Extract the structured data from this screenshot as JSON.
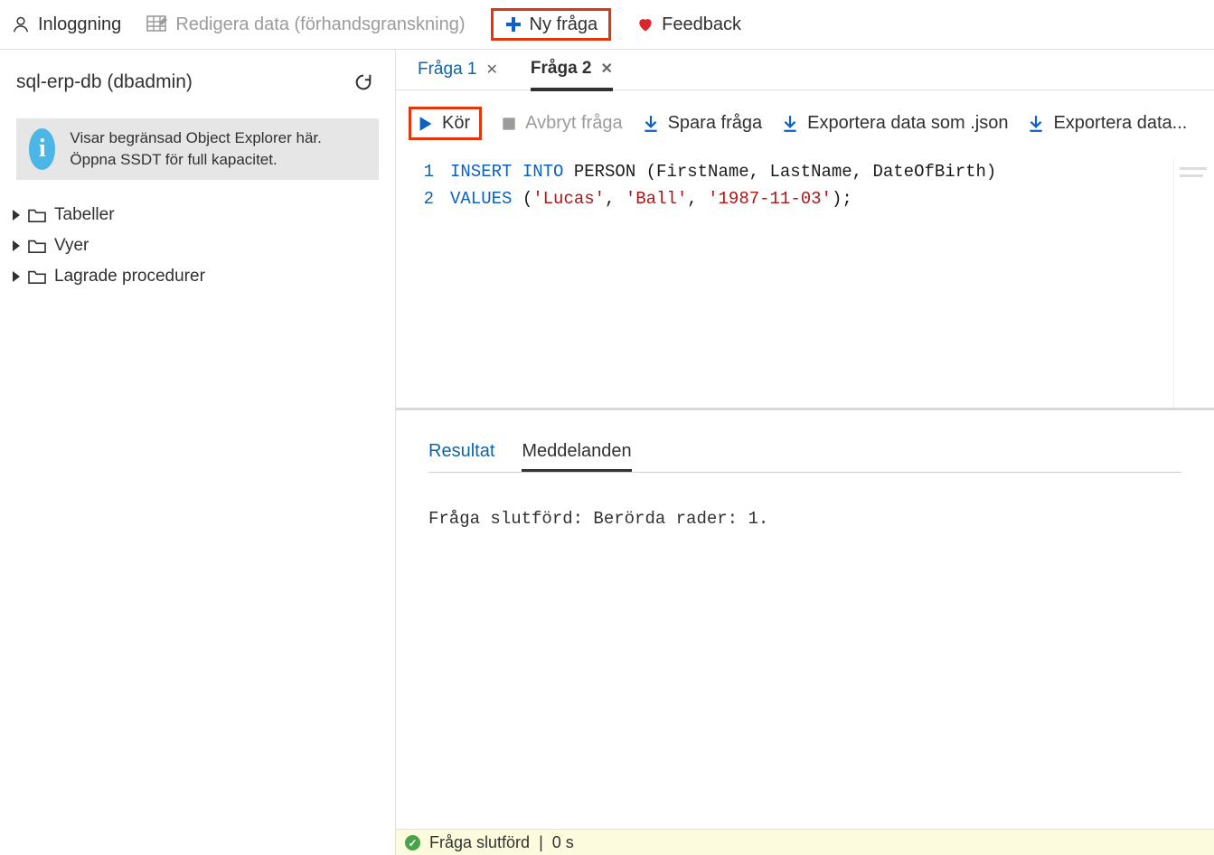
{
  "topbar": {
    "login_label": "Inloggning",
    "edit_data_label": "Redigera data (förhandsgranskning)",
    "new_query_label": "Ny fråga",
    "feedback_label": "Feedback"
  },
  "sidebar": {
    "db_title": "sql-erp-db (dbadmin)",
    "info_text": "Visar begränsad Object Explorer här. Öppna SSDT för full kapacitet.",
    "tree": {
      "tables": "Tabeller",
      "views": "Vyer",
      "sprocs": "Lagrade procedurer"
    }
  },
  "tabs": [
    {
      "label": "Fråga 1",
      "active": false
    },
    {
      "label": "Fråga 2",
      "active": true
    }
  ],
  "qtoolbar": {
    "run": "Kör",
    "cancel": "Avbryt fråga",
    "save": "Spara fråga",
    "export_json": "Exportera data som .json",
    "export_more": "Exportera data..."
  },
  "editor": {
    "lines": [
      "1",
      "2"
    ],
    "tokens": [
      [
        {
          "t": "INSERT INTO",
          "c": "kw"
        },
        {
          "t": " PERSON (FirstName, LastName, DateOfBirth)",
          "c": "txt"
        }
      ],
      [
        {
          "t": "VALUES",
          "c": "kw"
        },
        {
          "t": " (",
          "c": "txt"
        },
        {
          "t": "'Lucas'",
          "c": "str"
        },
        {
          "t": ", ",
          "c": "txt"
        },
        {
          "t": "'Ball'",
          "c": "str"
        },
        {
          "t": ", ",
          "c": "txt"
        },
        {
          "t": "'1987-11-03'",
          "c": "str"
        },
        {
          "t": ");",
          "c": "txt"
        }
      ]
    ]
  },
  "results": {
    "tab_results": "Resultat",
    "tab_messages": "Meddelanden",
    "message_text": "Fråga slutförd: Berörda rader: 1."
  },
  "statusbar": {
    "text": "Fråga slutförd",
    "time": "0 s"
  }
}
